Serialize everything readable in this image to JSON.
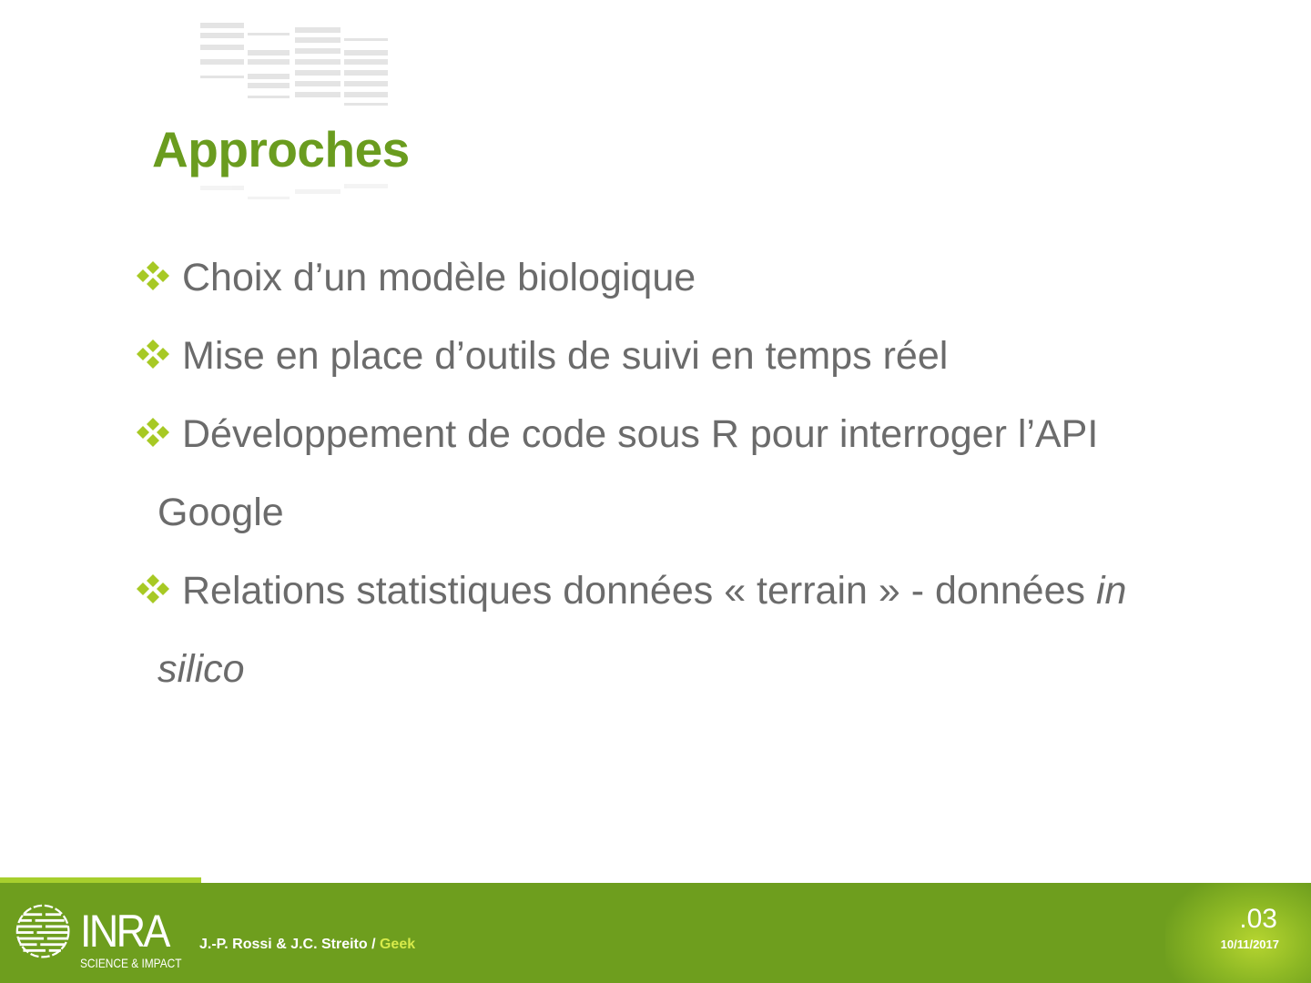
{
  "slide": {
    "title": "Approches",
    "bullets": [
      {
        "lines": [
          "Choix d’un modèle biologique"
        ]
      },
      {
        "lines": [
          "Mise en place d’outils de suivi en temps réel"
        ]
      },
      {
        "lines": [
          "Développement de code sous R pour interroger l’API",
          "Google"
        ]
      },
      {
        "lines": [
          "Relations statistiques données « terrain » - données ",
          "silico"
        ],
        "italic_tail": "in"
      }
    ],
    "colors": {
      "title": "#6a9c1f",
      "body": "#6b6b6b",
      "bullet": "#a7c924",
      "footer": "#6e9e1e"
    },
    "bullet_icon": "four-diamond-bullet-icon"
  },
  "footer": {
    "logo_text": "INRA",
    "logo_subtitle": "SCIENCE & IMPACT",
    "authors": "J.-P. Rossi & J.C. Streito / ",
    "event": "Geek",
    "page_number": ".03",
    "date": "10/11/2017"
  }
}
